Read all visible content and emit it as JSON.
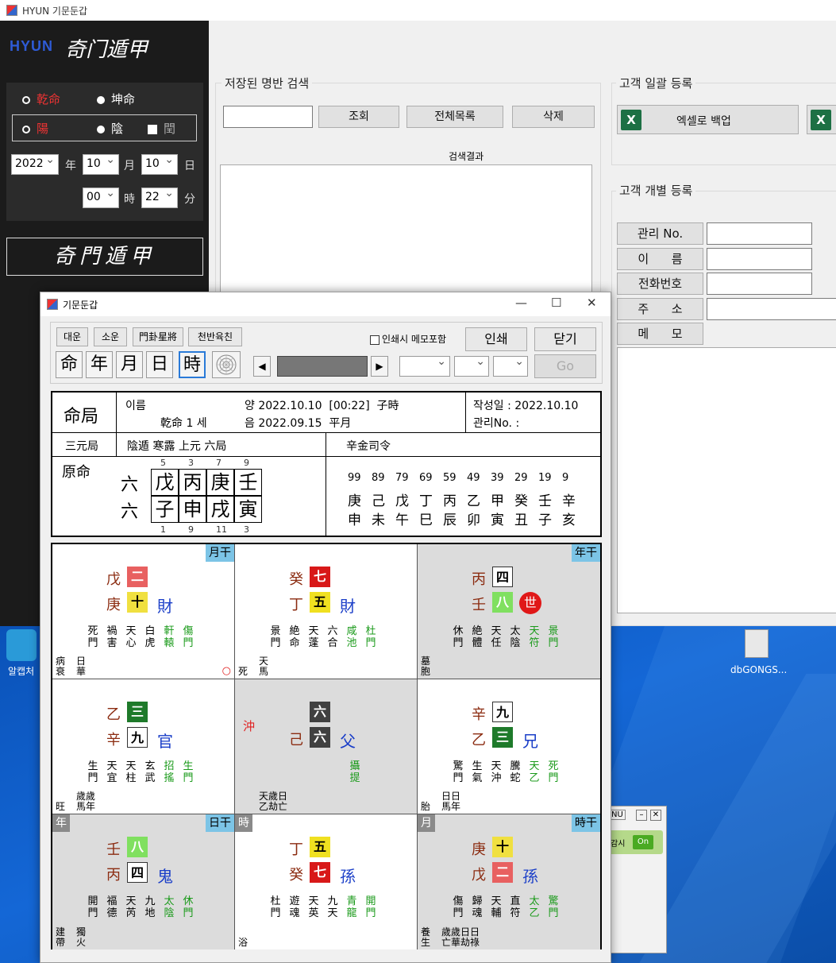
{
  "main": {
    "title": "HYUN 기문둔갑",
    "logo": "HYUN",
    "logo_script": "奇门遁甲",
    "male": "乾命",
    "female": "坤命",
    "yang": "陽",
    "yin": "陰",
    "leap": "閏",
    "year": "2022",
    "month": "10",
    "day": "10",
    "hour": "00",
    "minute": "22",
    "lbl_year": "年",
    "lbl_month": "月",
    "lbl_day": "日",
    "lbl_hour": "時",
    "lbl_min": "分",
    "big_button": "奇門遁甲"
  },
  "search": {
    "title": "저장된 명반 검색",
    "btn_query": "조회",
    "btn_all": "전체목록",
    "btn_delete": "삭제",
    "result_label": "검색결과"
  },
  "bulk": {
    "title": "고객 일괄 등록",
    "backup": "엑셀로 백업"
  },
  "single": {
    "title": "고객 개별 등록",
    "mgmt_no": "관리 No.",
    "name": "이      름",
    "phone": "전화번호",
    "address": "주      소",
    "memo": "메      모"
  },
  "desktop": {
    "icon1": "알캡처",
    "icon2": "dbGONGS...",
    "tray": "NU",
    "tray_on": "On",
    "tray_label": "감시"
  },
  "dialog": {
    "title": "기문둔갑",
    "b_daeun": "대운",
    "b_soun": "소운",
    "b_gwae": "門卦星將",
    "b_cheonban": "천반육친",
    "memo_check": "인쇄시 메모포함",
    "print": "인쇄",
    "close": "닫기",
    "go": "Go",
    "cbtns": [
      "命",
      "年",
      "月",
      "日",
      "時"
    ]
  },
  "chart": {
    "title": "命局",
    "name_label": "이름",
    "gender": "乾命 1 세",
    "solar": "양 2022.10.10  [00:22]  子時",
    "lunar": "음 2022.09.15  平月",
    "created": "작성일 : 2022.10.10",
    "mgmt": "관리No. :",
    "sanyuan": "三元局",
    "ju": "陰遁 寒露 上元 六局",
    "siling": "辛金司令",
    "yuanming": "原命",
    "row_label": [
      "六",
      "六"
    ],
    "top_nums": [
      "5",
      "3",
      "7",
      "9"
    ],
    "stems": [
      "戊",
      "丙",
      "庚",
      "壬"
    ],
    "branches": [
      "子",
      "申",
      "戌",
      "寅"
    ],
    "bot_nums": [
      "1",
      "9",
      "11",
      "3"
    ],
    "luck_ages": [
      "99",
      "89",
      "79",
      "69",
      "59",
      "49",
      "39",
      "29",
      "19",
      "9"
    ],
    "luck_stems": [
      "庚",
      "己",
      "戊",
      "丁",
      "丙",
      "乙",
      "甲",
      "癸",
      "壬",
      "辛"
    ],
    "luck_branches": [
      "申",
      "未",
      "午",
      "巳",
      "辰",
      "卯",
      "寅",
      "丑",
      "子",
      "亥"
    ]
  },
  "palaces": [
    {
      "tag": "月干",
      "s1": "戊",
      "s2": "庚",
      "n1": "二",
      "n2": "十",
      "god": "財",
      "cols": [
        [
          "死",
          "門"
        ],
        [
          "禍",
          "害"
        ],
        [
          "天",
          "心"
        ],
        [
          "白",
          "虎"
        ],
        [
          "軒",
          "轅"
        ],
        [
          "傷",
          "門"
        ]
      ],
      "bl": "病\n衰",
      "bm": "日\n華",
      "mark": "○"
    },
    {
      "s1": "癸",
      "s2": "丁",
      "n1": "七",
      "n2": "五",
      "god": "財",
      "cols": [
        [
          "景",
          "門"
        ],
        [
          "絶",
          "命"
        ],
        [
          "天",
          "蓬"
        ],
        [
          "六",
          "合"
        ],
        [
          "咸",
          "池"
        ],
        [
          "杜",
          "門"
        ]
      ],
      "bl": "死",
      "bm": "天\n馬"
    },
    {
      "tag": "年干",
      "s1": "丙",
      "s2": "壬",
      "n1": "四",
      "n2": "八",
      "god": "世",
      "cols": [
        [
          "休",
          "門"
        ],
        [
          "絶",
          "體"
        ],
        [
          "天",
          "任"
        ],
        [
          "太",
          "陰"
        ],
        [
          "天",
          "符"
        ],
        [
          "景",
          "門"
        ]
      ],
      "bl": "墓\n胞"
    },
    {
      "s1": "乙",
      "s2": "辛",
      "n1": "三",
      "n2": "九",
      "god": "官",
      "cols": [
        [
          "生",
          "門"
        ],
        [
          "天",
          "宜"
        ],
        [
          "天",
          "柱"
        ],
        [
          "玄",
          "武"
        ],
        [
          "招",
          "搖"
        ],
        [
          "生",
          "門"
        ]
      ],
      "bl": "旺",
      "bm": "歲歲\n馬年"
    },
    {
      "s1": "",
      "s2": "己",
      "n1": "六",
      "n2": "六",
      "god": "父",
      "chong": "沖",
      "cols": [
        [
          "攝",
          "提"
        ]
      ],
      "bm": "天歲日\n乙劫亡"
    },
    {
      "s1": "辛",
      "s2": "乙",
      "n1": "九",
      "n2": "三",
      "god": "兄",
      "cols": [
        [
          "驚",
          "門"
        ],
        [
          "生",
          "氣"
        ],
        [
          "天",
          "沖"
        ],
        [
          "騰",
          "蛇"
        ],
        [
          "天",
          "乙"
        ],
        [
          "死",
          "門"
        ]
      ],
      "bl": "胎",
      "bm": "日日\n馬年"
    },
    {
      "tag": "日干",
      "gtag": "年",
      "s1": "壬",
      "s2": "丙",
      "n1": "八",
      "n2": "四",
      "god": "鬼",
      "cols": [
        [
          "開",
          "門"
        ],
        [
          "福",
          "德"
        ],
        [
          "天",
          "芮"
        ],
        [
          "九",
          "地"
        ],
        [
          "太",
          "陰"
        ],
        [
          "休",
          "門"
        ]
      ],
      "bl": "建\n帶",
      "bm": "獨\n火"
    },
    {
      "gtag": "時",
      "s1": "丁",
      "s2": "癸",
      "n1": "五",
      "n2": "七",
      "god": "孫",
      "cols": [
        [
          "杜",
          "門"
        ],
        [
          "遊",
          "魂"
        ],
        [
          "天",
          "英"
        ],
        [
          "九",
          "天"
        ],
        [
          "青",
          "龍"
        ],
        [
          "開",
          "門"
        ]
      ],
      "bl": "浴"
    },
    {
      "tag": "時干",
      "gtag": "月",
      "s1": "庚",
      "s2": "戊",
      "n1": "十",
      "n2": "二",
      "god": "孫",
      "cols": [
        [
          "傷",
          "門"
        ],
        [
          "歸",
          "魂"
        ],
        [
          "天",
          "輔"
        ],
        [
          "直",
          "符"
        ],
        [
          "太",
          "乙"
        ],
        [
          "驚",
          "門"
        ]
      ],
      "bl": "養\n生",
      "bm": "歲歲日日\n亡華劫祿"
    }
  ],
  "colors": {
    "num_二": "#e86060",
    "num_十": "#f0e040",
    "num_七": "#e02020",
    "num_五": "#f0e020",
    "num_四": "#ffffff",
    "num_八": "#80e060",
    "num_三": "#1e7a2a",
    "num_九": "#ffffff",
    "num_六": "#404040",
    "green_text": "#1a9a1a"
  }
}
